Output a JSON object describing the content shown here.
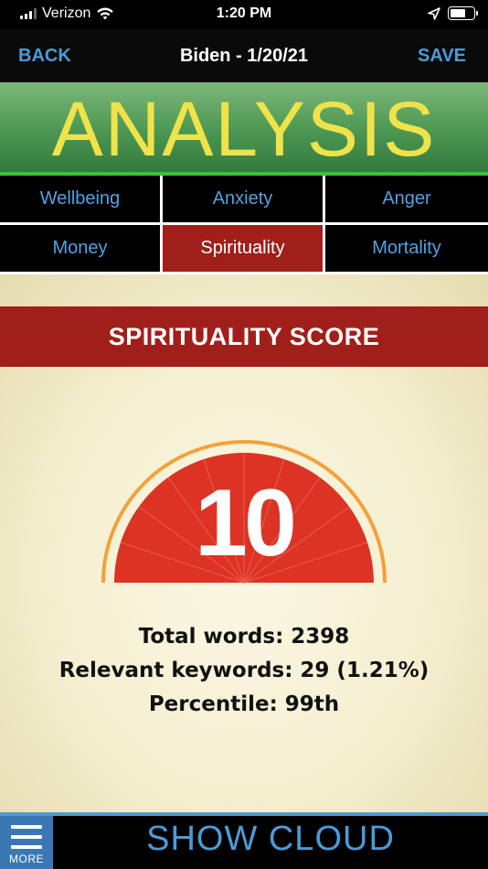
{
  "status_bar": {
    "carrier": "Verizon",
    "time": "1:20 PM",
    "battery_level": 0.68
  },
  "nav": {
    "back_label": "BACK",
    "title": "Biden - 1/20/21",
    "save_label": "SAVE"
  },
  "banner": {
    "title": "ANALYSIS"
  },
  "tabs": [
    {
      "label": "Wellbeing",
      "active": false
    },
    {
      "label": "Anxiety",
      "active": false
    },
    {
      "label": "Anger",
      "active": false
    },
    {
      "label": "Money",
      "active": false
    },
    {
      "label": "Spirituality",
      "active": true
    },
    {
      "label": "Mortality",
      "active": false
    }
  ],
  "score": {
    "header": "SPIRITUALITY SCORE",
    "value": "10",
    "stats": {
      "total_words": "Total words: 2398",
      "relevant_keywords": "Relevant keywords: 29 (1.21%)",
      "percentile": "Percentile: 99th"
    }
  },
  "bottom_bar": {
    "more_label": "MORE",
    "show_cloud_label": "SHOW CLOUD"
  },
  "colors": {
    "accent_blue": "#4b9bd6",
    "active_tab_red": "#a11f1a",
    "banner_title_yellow": "#f0e34a",
    "gauge_red": "#dc3325",
    "gauge_ring_orange": "#f3a13b"
  },
  "icons": {
    "menu": "hamburger-icon",
    "wifi": "wifi-icon",
    "location": "location-arrow-icon",
    "battery": "battery-icon"
  }
}
